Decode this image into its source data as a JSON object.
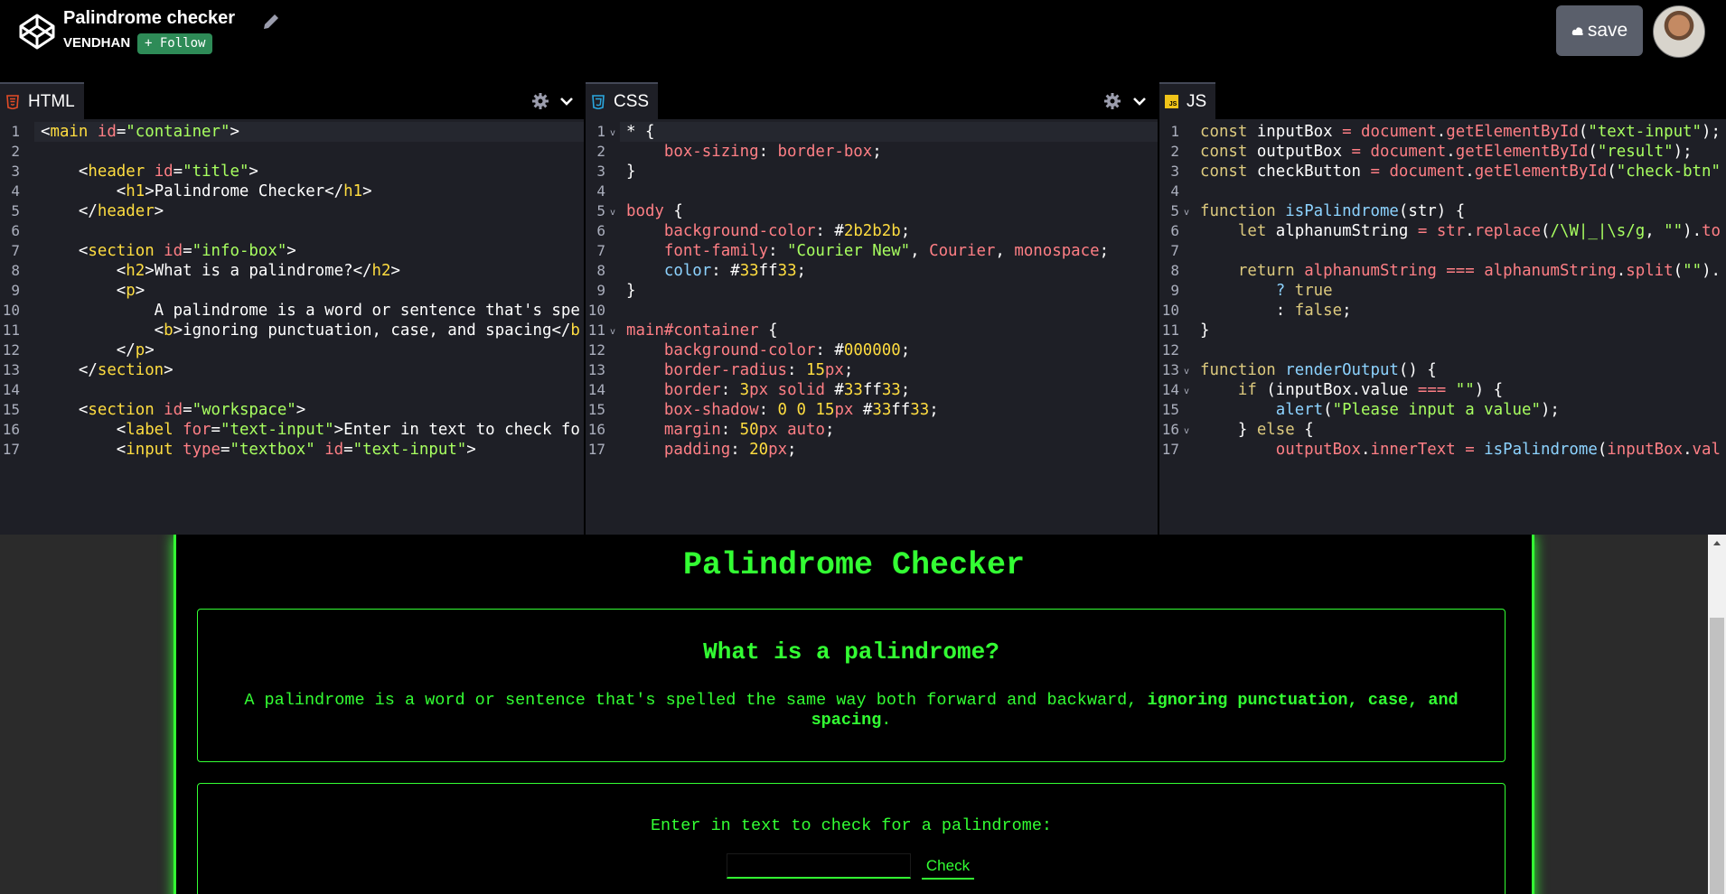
{
  "header": {
    "title": "Palindrome checker",
    "author": "VENDHAN",
    "follow_label": "+ Follow",
    "save_label": "save"
  },
  "panes": {
    "html": {
      "tab_label": "HTML"
    },
    "css": {
      "tab_label": "CSS"
    },
    "js": {
      "tab_label": "JS",
      "icon_text": "JS"
    }
  },
  "html_code": [
    [
      [
        "t-tag",
        "<"
      ],
      [
        "t-name",
        "main"
      ],
      [
        "t-plain",
        " "
      ],
      [
        "t-attr",
        "id"
      ],
      [
        "t-plain",
        "="
      ],
      [
        "t-val",
        "\"container\""
      ],
      [
        "t-tag",
        ">"
      ]
    ],
    [],
    [
      [
        "t-plain",
        "    "
      ],
      [
        "t-tag",
        "<"
      ],
      [
        "t-name",
        "header"
      ],
      [
        "t-plain",
        " "
      ],
      [
        "t-attr",
        "id"
      ],
      [
        "t-plain",
        "="
      ],
      [
        "t-val",
        "\"title\""
      ],
      [
        "t-tag",
        ">"
      ]
    ],
    [
      [
        "t-plain",
        "        "
      ],
      [
        "t-tag",
        "<"
      ],
      [
        "t-name",
        "h1"
      ],
      [
        "t-tag",
        ">"
      ],
      [
        "t-plain",
        "Palindrome Checker"
      ],
      [
        "t-tag",
        "</"
      ],
      [
        "t-name",
        "h1"
      ],
      [
        "t-tag",
        ">"
      ]
    ],
    [
      [
        "t-plain",
        "    "
      ],
      [
        "t-tag",
        "</"
      ],
      [
        "t-name",
        "header"
      ],
      [
        "t-tag",
        ">"
      ]
    ],
    [],
    [
      [
        "t-plain",
        "    "
      ],
      [
        "t-tag",
        "<"
      ],
      [
        "t-name",
        "section"
      ],
      [
        "t-plain",
        " "
      ],
      [
        "t-attr",
        "id"
      ],
      [
        "t-plain",
        "="
      ],
      [
        "t-val",
        "\"info-box\""
      ],
      [
        "t-tag",
        ">"
      ]
    ],
    [
      [
        "t-plain",
        "        "
      ],
      [
        "t-tag",
        "<"
      ],
      [
        "t-name",
        "h2"
      ],
      [
        "t-tag",
        ">"
      ],
      [
        "t-plain",
        "What is a palindrome?"
      ],
      [
        "t-tag",
        "</"
      ],
      [
        "t-name",
        "h2"
      ],
      [
        "t-tag",
        ">"
      ]
    ],
    [
      [
        "t-plain",
        "        "
      ],
      [
        "t-tag",
        "<"
      ],
      [
        "t-name",
        "p"
      ],
      [
        "t-tag",
        ">"
      ]
    ],
    [
      [
        "t-plain",
        "            A palindrome is a word or sentence that's spe"
      ]
    ],
    [
      [
        "t-plain",
        "            "
      ],
      [
        "t-tag",
        "<"
      ],
      [
        "t-name",
        "b"
      ],
      [
        "t-tag",
        ">"
      ],
      [
        "t-plain",
        "ignoring punctuation, case, and spacing"
      ],
      [
        "t-tag",
        "</"
      ],
      [
        "t-name",
        "b"
      ]
    ],
    [
      [
        "t-plain",
        "        "
      ],
      [
        "t-tag",
        "</"
      ],
      [
        "t-name",
        "p"
      ],
      [
        "t-tag",
        ">"
      ]
    ],
    [
      [
        "t-plain",
        "    "
      ],
      [
        "t-tag",
        "</"
      ],
      [
        "t-name",
        "section"
      ],
      [
        "t-tag",
        ">"
      ]
    ],
    [],
    [
      [
        "t-plain",
        "    "
      ],
      [
        "t-tag",
        "<"
      ],
      [
        "t-name",
        "section"
      ],
      [
        "t-plain",
        " "
      ],
      [
        "t-attr",
        "id"
      ],
      [
        "t-plain",
        "="
      ],
      [
        "t-val",
        "\"workspace\""
      ],
      [
        "t-tag",
        ">"
      ]
    ],
    [
      [
        "t-plain",
        "        "
      ],
      [
        "t-tag",
        "<"
      ],
      [
        "t-name",
        "label"
      ],
      [
        "t-plain",
        " "
      ],
      [
        "t-attr",
        "for"
      ],
      [
        "t-plain",
        "="
      ],
      [
        "t-val",
        "\"text-input\""
      ],
      [
        "t-tag",
        ">"
      ],
      [
        "t-plain",
        "Enter in text to check fo"
      ]
    ],
    [
      [
        "t-plain",
        "        "
      ],
      [
        "t-tag",
        "<"
      ],
      [
        "t-name",
        "input"
      ],
      [
        "t-plain",
        " "
      ],
      [
        "t-attr",
        "type"
      ],
      [
        "t-plain",
        "="
      ],
      [
        "t-val",
        "\"textbox\""
      ],
      [
        "t-plain",
        " "
      ],
      [
        "t-attr",
        "id"
      ],
      [
        "t-plain",
        "="
      ],
      [
        "t-val",
        "\"text-input\""
      ],
      [
        "t-tag",
        ">"
      ]
    ]
  ],
  "css_code": [
    [
      [
        "t-plain",
        "* {"
      ]
    ],
    [
      [
        "t-plain",
        "    "
      ],
      [
        "t-prop",
        "box-sizing"
      ],
      [
        "t-plain",
        ": "
      ],
      [
        "t-attr",
        "border-box"
      ],
      [
        "t-plain",
        ";"
      ]
    ],
    [
      [
        "t-plain",
        "}"
      ]
    ],
    [],
    [
      [
        "t-sel",
        "body"
      ],
      [
        "t-plain",
        " {"
      ]
    ],
    [
      [
        "t-plain",
        "    "
      ],
      [
        "t-prop",
        "background-color"
      ],
      [
        "t-plain",
        ": "
      ],
      [
        "t-plain",
        "#"
      ],
      [
        "t-num",
        "2b2b2b"
      ],
      [
        "t-plain",
        ";"
      ]
    ],
    [
      [
        "t-plain",
        "    "
      ],
      [
        "t-prop",
        "font-family"
      ],
      [
        "t-plain",
        ": "
      ],
      [
        "t-val",
        "\"Courier New\""
      ],
      [
        "t-plain",
        ", "
      ],
      [
        "t-attr",
        "Courier"
      ],
      [
        "t-plain",
        ", "
      ],
      [
        "t-attr",
        "monospace"
      ],
      [
        "t-plain",
        ";"
      ]
    ],
    [
      [
        "t-plain",
        "    "
      ],
      [
        "t-fn",
        "color"
      ],
      [
        "t-plain",
        ": "
      ],
      [
        "t-plain",
        "#"
      ],
      [
        "t-num",
        "33"
      ],
      [
        "t-plain",
        "ff"
      ],
      [
        "t-num",
        "33"
      ],
      [
        "t-plain",
        ";"
      ]
    ],
    [
      [
        "t-plain",
        "}"
      ]
    ],
    [],
    [
      [
        "t-sel",
        "main#container"
      ],
      [
        "t-plain",
        " {"
      ]
    ],
    [
      [
        "t-plain",
        "    "
      ],
      [
        "t-prop",
        "background-color"
      ],
      [
        "t-plain",
        ": "
      ],
      [
        "t-plain",
        "#"
      ],
      [
        "t-num",
        "000000"
      ],
      [
        "t-plain",
        ";"
      ]
    ],
    [
      [
        "t-plain",
        "    "
      ],
      [
        "t-prop",
        "border-radius"
      ],
      [
        "t-plain",
        ": "
      ],
      [
        "t-num",
        "15"
      ],
      [
        "t-attr",
        "px"
      ],
      [
        "t-plain",
        ";"
      ]
    ],
    [
      [
        "t-plain",
        "    "
      ],
      [
        "t-prop",
        "border"
      ],
      [
        "t-plain",
        ": "
      ],
      [
        "t-num",
        "3"
      ],
      [
        "t-attr",
        "px"
      ],
      [
        "t-plain",
        " "
      ],
      [
        "t-attr",
        "solid"
      ],
      [
        "t-plain",
        " #"
      ],
      [
        "t-num",
        "33"
      ],
      [
        "t-plain",
        "ff"
      ],
      [
        "t-num",
        "33"
      ],
      [
        "t-plain",
        ";"
      ]
    ],
    [
      [
        "t-plain",
        "    "
      ],
      [
        "t-prop",
        "box-shadow"
      ],
      [
        "t-plain",
        ": "
      ],
      [
        "t-num",
        "0"
      ],
      [
        "t-plain",
        " "
      ],
      [
        "t-num",
        "0"
      ],
      [
        "t-plain",
        " "
      ],
      [
        "t-num",
        "15"
      ],
      [
        "t-attr",
        "px"
      ],
      [
        "t-plain",
        " #"
      ],
      [
        "t-num",
        "33"
      ],
      [
        "t-plain",
        "ff"
      ],
      [
        "t-num",
        "33"
      ],
      [
        "t-plain",
        ";"
      ]
    ],
    [
      [
        "t-plain",
        "    "
      ],
      [
        "t-prop",
        "margin"
      ],
      [
        "t-plain",
        ": "
      ],
      [
        "t-num",
        "50"
      ],
      [
        "t-attr",
        "px"
      ],
      [
        "t-plain",
        " "
      ],
      [
        "t-attr",
        "auto"
      ],
      [
        "t-plain",
        ";"
      ]
    ],
    [
      [
        "t-plain",
        "    "
      ],
      [
        "t-prop",
        "padding"
      ],
      [
        "t-plain",
        ": "
      ],
      [
        "t-num",
        "20"
      ],
      [
        "t-attr",
        "px"
      ],
      [
        "t-plain",
        ";"
      ]
    ]
  ],
  "js_code": [
    [
      [
        "t-kw2",
        "const"
      ],
      [
        "t-plain",
        " inputBox "
      ],
      [
        "t-kw",
        "="
      ],
      [
        "t-plain",
        " "
      ],
      [
        "t-kw",
        "document"
      ],
      [
        "t-plain",
        "."
      ],
      [
        "t-kw",
        "getElementById"
      ],
      [
        "t-plain",
        "("
      ],
      [
        "t-str",
        "\"text-input\""
      ],
      [
        "t-plain",
        ");"
      ]
    ],
    [
      [
        "t-kw2",
        "const"
      ],
      [
        "t-plain",
        " outputBox "
      ],
      [
        "t-kw",
        "="
      ],
      [
        "t-plain",
        " "
      ],
      [
        "t-kw",
        "document"
      ],
      [
        "t-plain",
        "."
      ],
      [
        "t-kw",
        "getElementById"
      ],
      [
        "t-plain",
        "("
      ],
      [
        "t-str",
        "\"result\""
      ],
      [
        "t-plain",
        ");"
      ]
    ],
    [
      [
        "t-kw2",
        "const"
      ],
      [
        "t-plain",
        " checkButton "
      ],
      [
        "t-kw",
        "="
      ],
      [
        "t-plain",
        " "
      ],
      [
        "t-kw",
        "document"
      ],
      [
        "t-plain",
        "."
      ],
      [
        "t-kw",
        "getElementById"
      ],
      [
        "t-plain",
        "("
      ],
      [
        "t-str",
        "\"check-btn\""
      ]
    ],
    [],
    [
      [
        "t-kw2",
        "function"
      ],
      [
        "t-plain",
        " "
      ],
      [
        "t-fn",
        "isPalindrome"
      ],
      [
        "t-plain",
        "(str) {"
      ]
    ],
    [
      [
        "t-plain",
        "    "
      ],
      [
        "t-kw2",
        "let"
      ],
      [
        "t-plain",
        " alphanumString "
      ],
      [
        "t-kw",
        "="
      ],
      [
        "t-plain",
        " "
      ],
      [
        "t-kw",
        "str"
      ],
      [
        "t-plain",
        "."
      ],
      [
        "t-kw",
        "replace"
      ],
      [
        "t-plain",
        "("
      ],
      [
        "t-str",
        "/\\W|_|\\s/g"
      ],
      [
        "t-plain",
        ", "
      ],
      [
        "t-str",
        "\"\""
      ],
      [
        "t-plain",
        ")."
      ],
      [
        "t-kw",
        "to"
      ]
    ],
    [],
    [
      [
        "t-plain",
        "    "
      ],
      [
        "t-kw2",
        "return"
      ],
      [
        "t-plain",
        " "
      ],
      [
        "t-kw",
        "alphanumString"
      ],
      [
        "t-plain",
        " "
      ],
      [
        "t-kw",
        "==="
      ],
      [
        "t-plain",
        " "
      ],
      [
        "t-kw",
        "alphanumString"
      ],
      [
        "t-plain",
        "."
      ],
      [
        "t-kw",
        "split"
      ],
      [
        "t-plain",
        "("
      ],
      [
        "t-str",
        "\"\""
      ],
      [
        "t-plain",
        ")."
      ]
    ],
    [
      [
        "t-plain",
        "        "
      ],
      [
        "t-fn",
        "?"
      ],
      [
        "t-plain",
        " "
      ],
      [
        "t-kw2",
        "true"
      ]
    ],
    [
      [
        "t-plain",
        "        "
      ],
      [
        "t-plain",
        ": "
      ],
      [
        "t-kw2",
        "false"
      ],
      [
        "t-plain",
        ";"
      ]
    ],
    [
      [
        "t-plain",
        "}"
      ]
    ],
    [],
    [
      [
        "t-kw2",
        "function"
      ],
      [
        "t-plain",
        " "
      ],
      [
        "t-fn",
        "renderOutput"
      ],
      [
        "t-plain",
        "() {"
      ]
    ],
    [
      [
        "t-plain",
        "    "
      ],
      [
        "t-kw2",
        "if"
      ],
      [
        "t-plain",
        " (inputBox.value "
      ],
      [
        "t-kw",
        "==="
      ],
      [
        "t-plain",
        " "
      ],
      [
        "t-str",
        "\"\""
      ],
      [
        "t-plain",
        ") {"
      ]
    ],
    [
      [
        "t-plain",
        "        "
      ],
      [
        "t-fn",
        "alert"
      ],
      [
        "t-plain",
        "("
      ],
      [
        "t-str",
        "\"Please input a value\""
      ],
      [
        "t-plain",
        ");"
      ]
    ],
    [
      [
        "t-plain",
        "    } "
      ],
      [
        "t-kw2",
        "else"
      ],
      [
        "t-plain",
        " {"
      ]
    ],
    [
      [
        "t-plain",
        "        "
      ],
      [
        "t-kw",
        "outputBox"
      ],
      [
        "t-plain",
        "."
      ],
      [
        "t-kw",
        "innerText"
      ],
      [
        "t-plain",
        " "
      ],
      [
        "t-kw",
        "="
      ],
      [
        "t-plain",
        " "
      ],
      [
        "t-fn",
        "isPalindrome"
      ],
      [
        "t-plain",
        "("
      ],
      [
        "t-kw",
        "inputBox"
      ],
      [
        "t-plain",
        "."
      ],
      [
        "t-kw",
        "val"
      ]
    ]
  ],
  "css_folds": [
    1,
    5,
    11
  ],
  "js_folds": [
    5,
    13,
    14,
    16
  ],
  "preview": {
    "title": "Palindrome Checker",
    "info_heading": "What is a palindrome?",
    "info_text": "A palindrome is a word or sentence that's spelled the same way both forward and backward, ",
    "info_bold": "ignoring punctuation, case, and spacing",
    "info_end": ".",
    "label": "Enter in text to check for a palindrome:",
    "input_value": "",
    "button_label": "Check"
  },
  "colors": {
    "accent": "#33ff33",
    "follow_bg": "#2e8b57",
    "editor_bg": "#1e1f26",
    "preview_bg": "#2b2b2b"
  }
}
